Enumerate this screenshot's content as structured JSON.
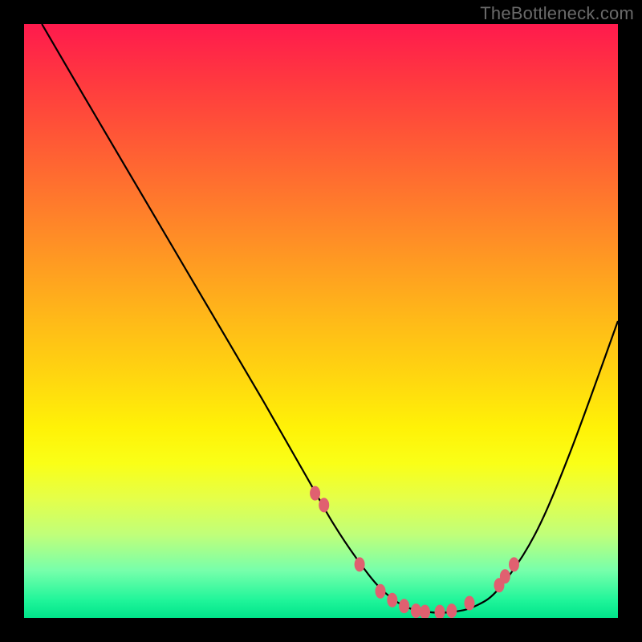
{
  "watermark": "TheBottleneck.com",
  "chart_data": {
    "type": "line",
    "title": "",
    "xlabel": "",
    "ylabel": "",
    "xlim": [
      0,
      100
    ],
    "ylim": [
      0,
      100
    ],
    "grid": false,
    "series": [
      {
        "name": "bottleneck-curve",
        "x": [
          3,
          10,
          20,
          30,
          40,
          48,
          52,
          56,
          60,
          64,
          68,
          72,
          76,
          80,
          86,
          92,
          100
        ],
        "y": [
          100,
          88,
          71,
          54,
          37,
          23,
          16,
          10,
          5,
          2,
          1,
          1,
          2,
          5,
          14,
          28,
          50
        ]
      }
    ],
    "markers": {
      "name": "highlight-dots",
      "color": "#e06070",
      "x": [
        49,
        50.5,
        56.5,
        60,
        62,
        64,
        66,
        67.5,
        70,
        72,
        75,
        80,
        81,
        82.5
      ],
      "y": [
        21,
        19,
        9,
        4.5,
        3,
        2,
        1.2,
        1,
        1,
        1.2,
        2.5,
        5.5,
        7,
        9
      ]
    },
    "background_gradient": {
      "top": "#ff1a4d",
      "mid": "#ffd80f",
      "bottom": "#00e48a"
    }
  }
}
